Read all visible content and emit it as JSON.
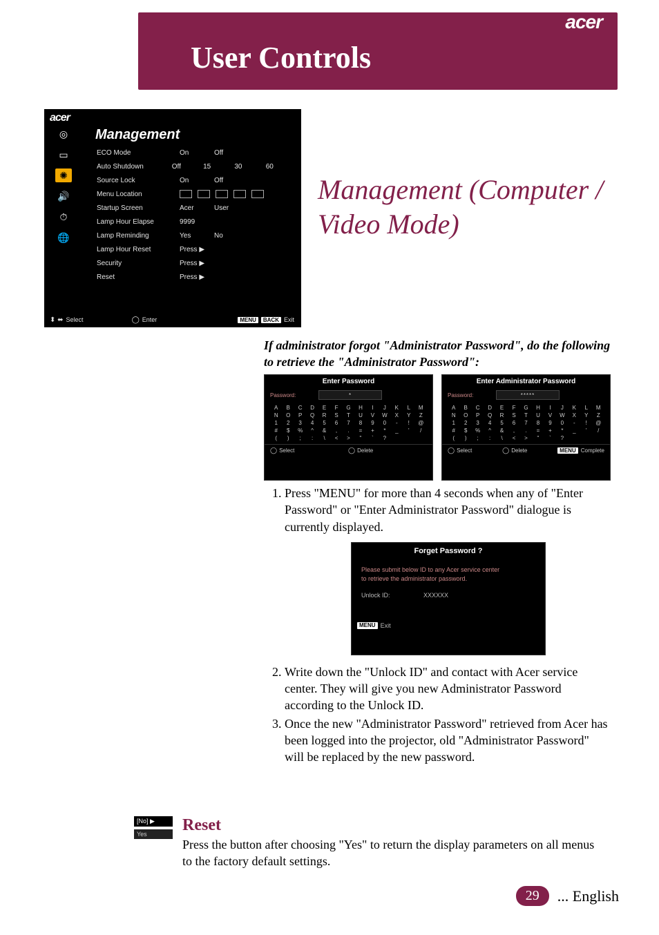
{
  "header": {
    "brand": "acer",
    "title": "User Controls"
  },
  "section_title": "Management (Computer / Video Mode)",
  "osd": {
    "brand": "acer",
    "heading": "Management",
    "rows": [
      {
        "label": "ECO Mode",
        "opts": [
          "On",
          "Off"
        ]
      },
      {
        "label": "Auto Shutdown",
        "opts": [
          "Off",
          "15",
          "30",
          "60"
        ]
      },
      {
        "label": "Source Lock",
        "opts": [
          "On",
          "Off"
        ]
      },
      {
        "label": "Menu Location",
        "opts": []
      },
      {
        "label": "Startup Screen",
        "opts": [
          "Acer",
          "User"
        ]
      },
      {
        "label": "Lamp Hour Elapse",
        "opts": [
          "9999"
        ]
      },
      {
        "label": "Lamp Reminding",
        "opts": [
          "Yes",
          "No"
        ]
      },
      {
        "label": "Lamp Hour Reset",
        "opts": [
          "Press ▶"
        ]
      },
      {
        "label": "Security",
        "opts": [
          "Press ▶"
        ]
      },
      {
        "label": "Reset",
        "opts": [
          "Press ▶"
        ]
      }
    ],
    "footer": {
      "select": "Select",
      "enter": "Enter",
      "menu": "MENU",
      "back": "BACK",
      "exit": "Exit"
    }
  },
  "intro": "If administrator forgot \"Administrator Password\", do the following to retrieve the \"Administrator Password\":",
  "kb_left": {
    "title": "Enter Password",
    "pw_label": "Password:",
    "pw_value": "*",
    "foot_select": "Select",
    "foot_delete": "Delete"
  },
  "kb_right": {
    "title": "Enter Administrator Password",
    "pw_label": "Password:",
    "pw_value": "*****",
    "foot_select": "Select",
    "foot_delete": "Delete",
    "foot_menu": "MENU",
    "foot_complete": "Complete"
  },
  "kb_grid": [
    "A",
    "B",
    "C",
    "D",
    "E",
    "F",
    "G",
    "H",
    "I",
    "J",
    "K",
    "L",
    "M",
    "N",
    "O",
    "P",
    "Q",
    "R",
    "S",
    "T",
    "U",
    "V",
    "W",
    "X",
    "Y",
    "Z",
    "1",
    "2",
    "3",
    "4",
    "5",
    "6",
    "7",
    "8",
    "9",
    "0",
    "-",
    "!",
    "@",
    "#",
    "$",
    "%",
    "^",
    "&",
    ",",
    ".",
    "=",
    "+",
    "*",
    "_",
    "'",
    "/",
    "(",
    ")",
    ";",
    ":",
    "\\",
    "<",
    ">",
    "\"",
    "`",
    "?",
    "",
    "",
    ""
  ],
  "steps": {
    "s1": "Press \"MENU\" for more than 4 seconds when any of \"Enter Password\" or \"Enter Administrator Password\" dialogue is currently displayed.",
    "s2": "Write down the \"Unlock ID\" and contact with Acer service center. They will give you new Administrator Password according to the Unlock ID.",
    "s3": "Once the new \"Administrator Password\" retrieved from Acer has been logged into the projector, old \"Administrator Password\" will be replaced by the new password."
  },
  "fp": {
    "title": "Forget Password ?",
    "msg1": "Please submit below ID to any Acer service center",
    "msg2": "to retrieve the administrator password.",
    "unlock_label": "Unlock ID:",
    "unlock_value": "XXXXXX",
    "menu": "MENU",
    "exit": "Exit"
  },
  "reset": {
    "btn_no": "[No] ▶",
    "btn_yes": "Yes",
    "heading": "Reset",
    "body": "Press the  button after choosing \"Yes\" to return the display parameters on all menus to the factory default settings."
  },
  "footer": {
    "page": "29",
    "lang": "... English"
  }
}
